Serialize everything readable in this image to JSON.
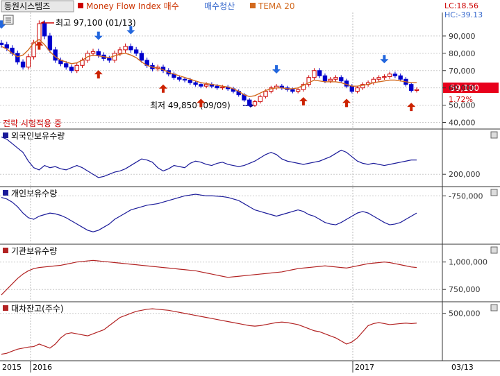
{
  "header": {
    "stock_name": "동원시스템즈",
    "indicator_1": "Money Flow Index 매수",
    "indicator_2": "매수청산",
    "indicator_3": "TEMA 20",
    "lc_label": "LC:18.56",
    "hc_label": "HC:-39.13"
  },
  "annotations": {
    "high_label": "최고 97,100 (01/13)",
    "low_label": "최저 49,850 (09/09)",
    "strategy_label": "전략 시험적용 중",
    "current_price": "59,100",
    "current_change": "1.72%"
  },
  "x_axis": {
    "labels": [
      "2015",
      "2016",
      "2017",
      "03/13"
    ]
  },
  "colors": {
    "price_up": "#cc0000",
    "price_down": "#0000cc",
    "tema": "#d2691e",
    "buy_arrow": "#cc2200",
    "sell_arrow": "#2266dd",
    "panel_line_blue": "#1a1a99",
    "panel_line_red": "#b22222",
    "price_box": "#e8001c",
    "axis_text": "#333333"
  },
  "chart_data": [
    {
      "type": "candlestick",
      "title": "동원시스템즈",
      "y_ticks": [
        "90,000",
        "80,000",
        "70,000",
        "60,000",
        "50,000",
        "40,000"
      ],
      "ylim": [
        37000,
        102000
      ],
      "x_range": [
        "2015-12",
        "2017-03-13"
      ],
      "high": {
        "value": 97100,
        "date": "01/13"
      },
      "low": {
        "value": 49850,
        "date": "09/09"
      },
      "last_close": 59100,
      "change_pct": 1.72,
      "close": [
        85000,
        83000,
        80000,
        75000,
        72000,
        78000,
        86000,
        97100,
        90000,
        82000,
        76000,
        74000,
        72000,
        70000,
        73000,
        76000,
        80000,
        81000,
        79000,
        77000,
        76000,
        80000,
        82000,
        84000,
        82000,
        80000,
        76000,
        73000,
        71000,
        72000,
        70000,
        68000,
        66000,
        65000,
        64500,
        63000,
        62000,
        61000,
        62000,
        61000,
        60000,
        60500,
        59500,
        58000,
        56000,
        53000,
        50000,
        52000,
        55000,
        58000,
        60000,
        61000,
        60000,
        59000,
        58000,
        59000,
        62000,
        66000,
        70000,
        67000,
        64000,
        65000,
        66000,
        64000,
        61000,
        58000,
        60000,
        62000,
        63000,
        65000,
        66000,
        66500,
        68000,
        67000,
        65000,
        62000,
        58500,
        59100
      ],
      "tema20": [
        84000,
        82500,
        80000,
        78000,
        79000,
        82000,
        86000,
        88000,
        85000,
        81000,
        78000,
        76000,
        75000,
        74000,
        74500,
        76000,
        78000,
        79000,
        78500,
        78000,
        77500,
        78500,
        79500,
        80000,
        79000,
        77500,
        75000,
        73000,
        72000,
        71500,
        70500,
        69000,
        68000,
        67000,
        66000,
        65000,
        64000,
        63000,
        62500,
        62000,
        61500,
        61000,
        60500,
        59500,
        58000,
        56000,
        55000,
        55500,
        57000,
        58500,
        59500,
        60000,
        60000,
        59500,
        59500,
        60000,
        61500,
        63000,
        64500,
        64000,
        63500,
        63500,
        63500,
        63000,
        62000,
        61000,
        61000,
        61500,
        62000,
        63000,
        63500,
        64000,
        64500,
        64500,
        64000,
        63500,
        63000,
        63000
      ],
      "buy_signals": [
        {
          "index": 7,
          "label": ""
        },
        {
          "index": 18,
          "label": ""
        },
        {
          "index": 30,
          "label": ""
        },
        {
          "index": 37,
          "label": ""
        },
        {
          "index": 56,
          "label": ""
        },
        {
          "index": 64,
          "label": ""
        },
        {
          "index": 76,
          "label": ""
        }
      ],
      "sell_signals": [
        {
          "index": 0,
          "label": ""
        },
        {
          "index": 18,
          "label": ""
        },
        {
          "index": 24,
          "label": ""
        },
        {
          "index": 51,
          "label": ""
        },
        {
          "index": 71,
          "label": ""
        }
      ]
    },
    {
      "type": "line",
      "title": "외국인보유수량",
      "y_ticks": [
        "200,000"
      ],
      "ylim": [
        150000,
        400000
      ],
      "values": [
        370000,
        360000,
        340000,
        320000,
        300000,
        260000,
        230000,
        220000,
        240000,
        230000,
        235000,
        225000,
        220000,
        230000,
        240000,
        230000,
        215000,
        200000,
        185000,
        190000,
        200000,
        210000,
        215000,
        225000,
        240000,
        255000,
        270000,
        265000,
        255000,
        230000,
        215000,
        225000,
        240000,
        235000,
        230000,
        250000,
        260000,
        255000,
        245000,
        240000,
        250000,
        255000,
        245000,
        240000,
        235000,
        240000,
        250000,
        260000,
        275000,
        290000,
        300000,
        290000,
        270000,
        260000,
        255000,
        250000,
        245000,
        250000,
        255000,
        260000,
        270000,
        280000,
        295000,
        310000,
        300000,
        280000,
        260000,
        250000,
        245000,
        250000,
        245000,
        240000,
        245000,
        250000,
        255000,
        260000,
        265000,
        265000
      ]
    },
    {
      "type": "line",
      "title": "개인보유수량",
      "y_ticks": [
        "-750,000"
      ],
      "ylim": [
        -1050000,
        -700000
      ],
      "values": [
        -760000,
        -770000,
        -790000,
        -820000,
        -860000,
        -890000,
        -900000,
        -880000,
        -870000,
        -860000,
        -865000,
        -875000,
        -890000,
        -910000,
        -930000,
        -950000,
        -970000,
        -980000,
        -970000,
        -950000,
        -930000,
        -900000,
        -880000,
        -860000,
        -840000,
        -830000,
        -820000,
        -810000,
        -805000,
        -800000,
        -790000,
        -780000,
        -770000,
        -760000,
        -750000,
        -745000,
        -740000,
        -745000,
        -750000,
        -750000,
        -752000,
        -755000,
        -760000,
        -770000,
        -780000,
        -800000,
        -820000,
        -840000,
        -850000,
        -860000,
        -870000,
        -880000,
        -870000,
        -860000,
        -850000,
        -840000,
        -850000,
        -870000,
        -880000,
        -900000,
        -920000,
        -930000,
        -935000,
        -920000,
        -900000,
        -880000,
        -860000,
        -850000,
        -860000,
        -880000,
        -900000,
        -920000,
        -935000,
        -930000,
        -920000,
        -900000,
        -880000,
        -860000
      ]
    },
    {
      "type": "line",
      "title": "기관보유수량",
      "y_ticks": [
        "1,000,000",
        "750,000"
      ],
      "ylim": [
        650000,
        1150000
      ],
      "values": [
        700000,
        750000,
        800000,
        850000,
        890000,
        920000,
        940000,
        950000,
        955000,
        960000,
        965000,
        970000,
        980000,
        990000,
        1000000,
        1005000,
        1010000,
        1015000,
        1010000,
        1005000,
        1000000,
        995000,
        990000,
        985000,
        980000,
        975000,
        970000,
        965000,
        960000,
        955000,
        950000,
        945000,
        940000,
        935000,
        930000,
        925000,
        920000,
        910000,
        900000,
        890000,
        880000,
        870000,
        860000,
        865000,
        870000,
        875000,
        880000,
        885000,
        890000,
        895000,
        900000,
        905000,
        910000,
        920000,
        930000,
        940000,
        945000,
        950000,
        955000,
        960000,
        965000,
        960000,
        955000,
        950000,
        945000,
        955000,
        965000,
        975000,
        985000,
        990000,
        995000,
        1000000,
        995000,
        985000,
        975000,
        965000,
        955000,
        950000
      ]
    },
    {
      "type": "line",
      "title": "대차잔고(주수)",
      "y_ticks": [
        "500,000"
      ],
      "ylim": [
        50000,
        600000
      ],
      "values": [
        100000,
        110000,
        130000,
        150000,
        160000,
        170000,
        175000,
        200000,
        180000,
        160000,
        200000,
        260000,
        300000,
        310000,
        300000,
        290000,
        280000,
        300000,
        320000,
        340000,
        380000,
        420000,
        460000,
        480000,
        500000,
        520000,
        530000,
        540000,
        545000,
        540000,
        535000,
        530000,
        520000,
        510000,
        500000,
        490000,
        480000,
        470000,
        460000,
        450000,
        440000,
        430000,
        420000,
        410000,
        400000,
        390000,
        380000,
        375000,
        380000,
        390000,
        400000,
        410000,
        415000,
        410000,
        400000,
        390000,
        370000,
        350000,
        330000,
        320000,
        300000,
        280000,
        260000,
        230000,
        200000,
        220000,
        260000,
        320000,
        380000,
        400000,
        410000,
        400000,
        390000,
        395000,
        400000,
        405000,
        400000,
        405000
      ]
    }
  ]
}
